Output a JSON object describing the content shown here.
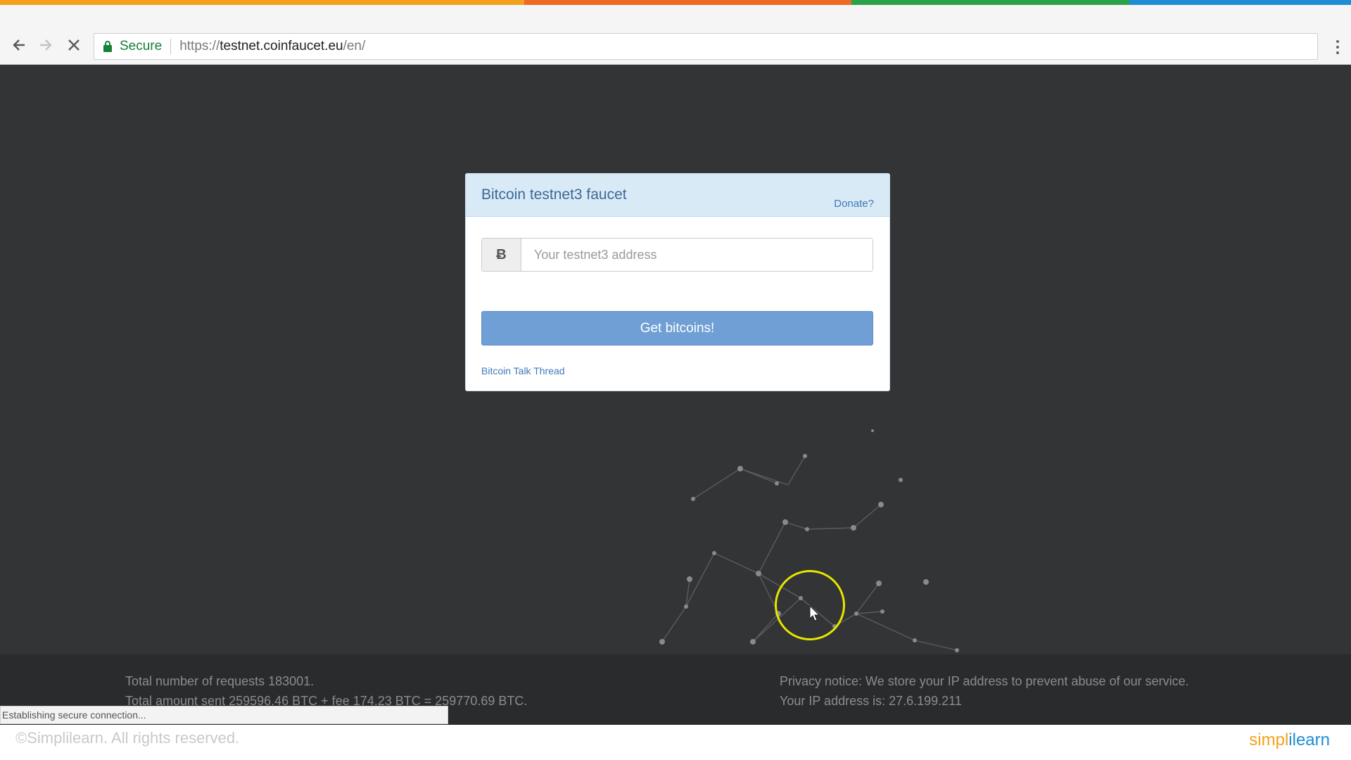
{
  "colors": {
    "stripe": [
      "#f3a11d",
      "#ef6a24",
      "#2aa24a",
      "#1f8dd6"
    ],
    "secure_green": "#188038",
    "card_header": "#d9eaf7",
    "button_blue": "#6f9fd4",
    "page_bg": "#333435",
    "cursor_ring": "#e6e600"
  },
  "browser": {
    "back_icon": "arrow-left-icon",
    "forward_icon": "arrow-right-icon",
    "stop_icon": "close-icon",
    "secure_label": "Secure",
    "url_scheme": "https://",
    "url_host": "testnet.coinfaucet.eu",
    "url_path": "/en/",
    "menu_icon": "kebab-menu-icon"
  },
  "faucet": {
    "title": "Bitcoin testnet3 faucet",
    "donate_link": "Donate?",
    "currency_symbol": "Ƀ",
    "address_placeholder": "Your testnet3 address",
    "address_value": "",
    "submit_label": "Get bitcoins!",
    "thread_link": "Bitcoin Talk Thread"
  },
  "footer": {
    "requests_text": "Total number of requests 183001.",
    "amount_text": "Total amount sent 259596.46 BTC + fee 174.23 BTC = 259770.69 BTC.",
    "privacy_text": "Privacy notice: We store your IP address to prevent abuse of our service.",
    "ip_text": "Your IP address is: 27.6.199.211"
  },
  "status_bar": "Establishing secure connection...",
  "watermark": {
    "copyright": "©Simplilearn. All rights reserved.",
    "brand_part1": "simpl",
    "brand_part2": "ilearn"
  }
}
